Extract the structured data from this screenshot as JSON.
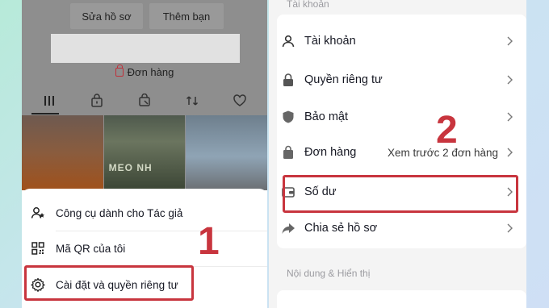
{
  "colors": {
    "accent_red": "#c8353e",
    "text_primary": "#161823",
    "text_secondary": "#9b9ba0",
    "background_gradient_start": "#b7ead9",
    "background_gradient_end": "#cfdff5"
  },
  "left_phone": {
    "profile_buttons": {
      "edit_profile": "Sửa hồ sơ",
      "add_friends": "Thêm bạn"
    },
    "orders_link": "Đơn hàng",
    "tabs": [
      {
        "icon": "grid-icon"
      },
      {
        "icon": "lock-bag-icon"
      },
      {
        "icon": "shop-icon"
      },
      {
        "icon": "repost-icon"
      },
      {
        "icon": "heart-icon"
      }
    ],
    "thumbnail_2_sign": "MEO NH",
    "menu": {
      "creator_tools": "Công cụ dành cho Tác giả",
      "qr_code": "Mã QR của tôi",
      "settings_privacy": "Cài đặt và quyền riêng tư"
    },
    "step_number": "1"
  },
  "right_phone": {
    "section_account_label": "Tài khoản",
    "rows": {
      "account": "Tài khoản",
      "privacy": "Quyền riêng tư",
      "security": "Bảo mật",
      "orders": "Đơn hàng",
      "orders_extra": "Xem trước 2 đơn hàng",
      "balance": "Số dư",
      "share_profile": "Chia sẻ hồ sơ"
    },
    "section_content_label": "Nội dung & Hiển thị",
    "step_number": "2"
  }
}
